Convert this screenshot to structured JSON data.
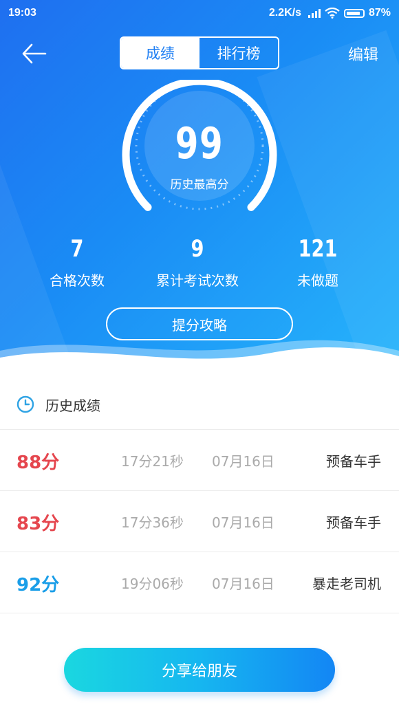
{
  "status_bar": {
    "time": "19:03",
    "network_speed": "2.2K/s",
    "battery": "87%"
  },
  "header": {
    "back_icon": "arrow-left-icon",
    "tabs": [
      {
        "label": "成绩",
        "active": true
      },
      {
        "label": "排行榜",
        "active": false
      }
    ],
    "edit_label": "编辑"
  },
  "gauge": {
    "score": "99",
    "label": "历史最高分"
  },
  "stats": [
    {
      "value": "7",
      "label": "合格次数"
    },
    {
      "value": "9",
      "label": "累计考试次数"
    },
    {
      "value": "121",
      "label": "未做题"
    }
  ],
  "tips_button": "提分攻略",
  "history": {
    "title": "历史成绩",
    "icon": "clock-icon",
    "rows": [
      {
        "score": "88分",
        "duration": "17分21秒",
        "date": "07月16日",
        "rank": "预备车手",
        "score_color": "#e5464e"
      },
      {
        "score": "83分",
        "duration": "17分36秒",
        "date": "07月16日",
        "rank": "预备车手",
        "score_color": "#e5464e"
      },
      {
        "score": "92分",
        "duration": "19分06秒",
        "date": "07月16日",
        "rank": "暴走老司机",
        "score_color": "#1a9ee8"
      }
    ]
  },
  "share_button": "分享给朋友",
  "colors": {
    "hero_start": "#1f6ff0",
    "hero_end": "#26b4fb",
    "fail_score": "#e5464e",
    "pass_score": "#1a9ee8"
  }
}
